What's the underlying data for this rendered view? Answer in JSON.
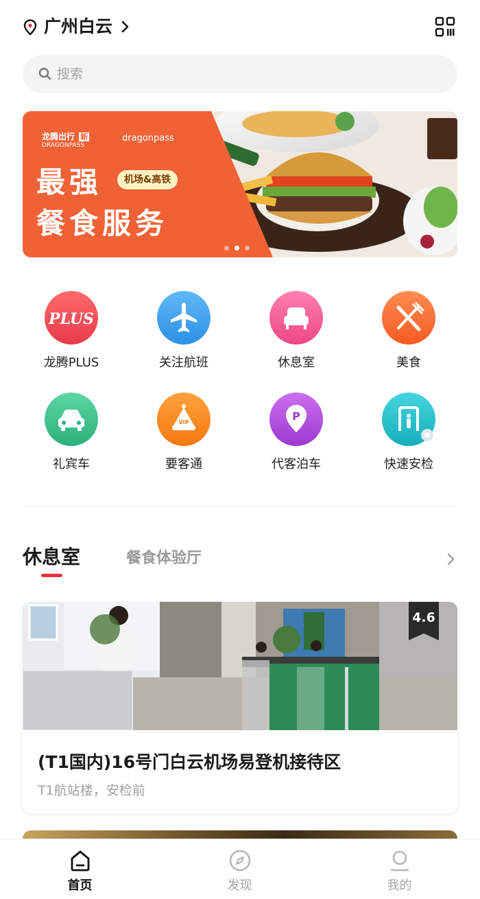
{
  "header": {
    "city": "广州白云",
    "icons": {
      "location": "location-pin-icon",
      "chevron": "chevron-right-icon",
      "qr": "qr-code-icon"
    }
  },
  "search": {
    "placeholder": "搜索",
    "icon": "search-icon"
  },
  "banner": {
    "brand_cn": "龙腾出行",
    "brand_badge": "新",
    "brand_en": "DRAGONPASS",
    "brand_secondary": "dragonpass",
    "headline_1": "最强",
    "tag": "机场&高铁",
    "headline_2": "餐食服务",
    "active_slide": 2,
    "slide_count": 3,
    "colors": {
      "background": "#f06236"
    }
  },
  "services": [
    {
      "label": "龙腾PLUS",
      "icon": "plus-badge-icon",
      "color": "#f04a56"
    },
    {
      "label": "关注航班",
      "icon": "airplane-icon",
      "color": "#3aa0ee"
    },
    {
      "label": "休息室",
      "icon": "sofa-icon",
      "color": "#f35a94"
    },
    {
      "label": "美食",
      "icon": "fork-knife-icon",
      "color": "#f8662e"
    },
    {
      "label": "礼宾车",
      "icon": "car-icon",
      "color": "#37c28c"
    },
    {
      "label": "要客通",
      "icon": "vip-crown-icon",
      "color": "#f88a1e"
    },
    {
      "label": "代客泊车",
      "icon": "parking-pin-icon",
      "color": "#b14bd9"
    },
    {
      "label": "快速安检",
      "icon": "security-gate-icon",
      "color": "#22c0c7"
    }
  ],
  "tabs": {
    "active": "休息室",
    "inactive": "餐食体验厅",
    "accent": "#e8313c"
  },
  "lounge_card": {
    "rating": "4.6",
    "title": "(T1国内)16号门白云机场易登机接待区",
    "subtitle": "T1航站楼，安检前"
  },
  "bottom_nav": [
    {
      "label": "首页",
      "icon": "home-icon",
      "active": true
    },
    {
      "label": "发现",
      "icon": "compass-icon",
      "active": false
    },
    {
      "label": "我的",
      "icon": "user-icon",
      "active": false
    }
  ]
}
